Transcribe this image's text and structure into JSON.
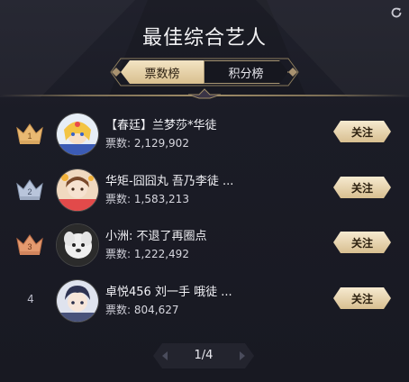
{
  "header": {
    "title": "最佳综合艺人"
  },
  "tabs": [
    {
      "label": "票数榜",
      "active": true
    },
    {
      "label": "积分榜",
      "active": false
    }
  ],
  "list": [
    {
      "rank": "1",
      "rank_icon": "crown-gold-icon",
      "name": "【春廷】兰梦莎*华徒",
      "votes_label": "票数:",
      "votes": "2,129,902",
      "follow_label": "关注"
    },
    {
      "rank": "2",
      "rank_icon": "crown-silver-icon",
      "name": "华矩-囧囧丸 吾乃李徒 ...",
      "votes_label": "票数:",
      "votes": "1,583,213",
      "follow_label": "关注"
    },
    {
      "rank": "3",
      "rank_icon": "crown-bronze-icon",
      "name": "小洲: 不退了再圈点",
      "votes_label": "票数:",
      "votes": "1,222,492",
      "follow_label": "关注"
    },
    {
      "rank": "4",
      "rank_icon": "",
      "name": "卓悦456 刘一手 哦徒 ...",
      "votes_label": "票数:",
      "votes": "804,627",
      "follow_label": "关注"
    }
  ],
  "pager": {
    "text": "1/4"
  },
  "colors": {
    "gold": "#d9bf8e",
    "crown_gold": "#e9b972",
    "crown_silver": "#aab8d0",
    "crown_bronze": "#e0956d",
    "background": "#1a1b24"
  }
}
